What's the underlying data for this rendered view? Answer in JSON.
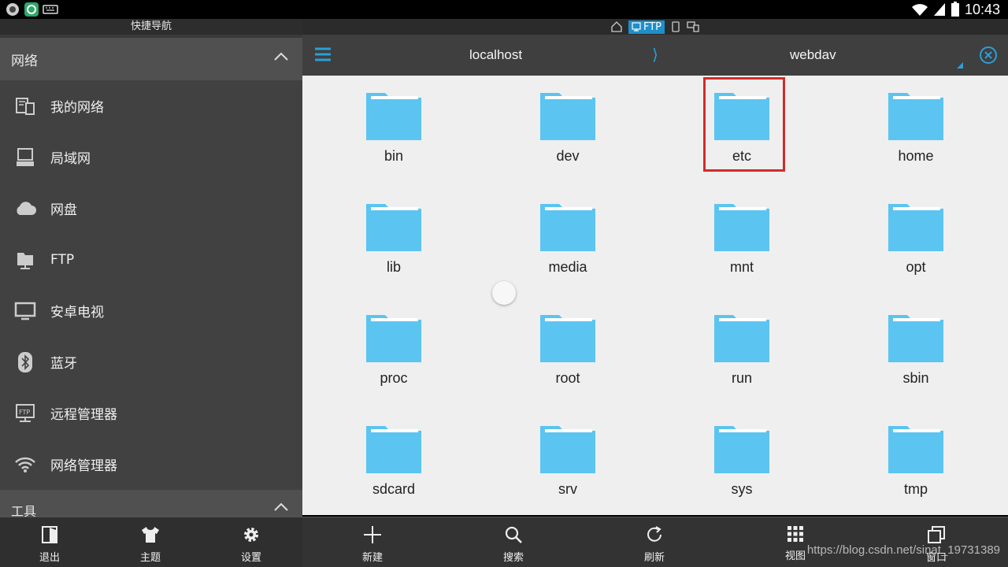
{
  "status": {
    "time": "10:43"
  },
  "sidebar": {
    "title": "快捷导航",
    "section": "网络",
    "items": [
      {
        "label": "我的网络",
        "icon": "my-network-icon"
      },
      {
        "label": "局域网",
        "icon": "computer-icon"
      },
      {
        "label": "网盘",
        "icon": "cloud-icon"
      },
      {
        "label": "FTP",
        "icon": "ftp-server-icon"
      },
      {
        "label": "安卓电视",
        "icon": "tv-icon"
      },
      {
        "label": "蓝牙",
        "icon": "bluetooth-icon"
      },
      {
        "label": "远程管理器",
        "icon": "remote-manager-icon"
      },
      {
        "label": "网络管理器",
        "icon": "wifi-icon"
      }
    ],
    "tools_section": "工具"
  },
  "topbar": {
    "ftp_label": "FTP"
  },
  "path": {
    "host": "localhost",
    "separator": "⟩",
    "current": "webdav"
  },
  "folders": [
    "bin",
    "dev",
    "etc",
    "home",
    "lib",
    "media",
    "mnt",
    "opt",
    "proc",
    "root",
    "run",
    "sbin",
    "sdcard",
    "srv",
    "sys",
    "tmp"
  ],
  "bottom_left": [
    {
      "label": "退出",
      "icon": "exit-icon"
    },
    {
      "label": "主题",
      "icon": "theme-shirt-icon"
    },
    {
      "label": "设置",
      "icon": "gear-icon"
    }
  ],
  "bottom_right": [
    {
      "label": "新建",
      "icon": "plus-icon"
    },
    {
      "label": "搜索",
      "icon": "search-icon"
    },
    {
      "label": "刷新",
      "icon": "refresh-icon"
    },
    {
      "label": "视图",
      "icon": "grid-view-icon"
    },
    {
      "label": "窗口",
      "icon": "windows-icon"
    }
  ],
  "watermark": "https://blog.csdn.net/sinat_19731389",
  "colors": {
    "folder": "#5bc4f0",
    "accent": "#2a9fd8",
    "highlight": "#d42a2a"
  }
}
